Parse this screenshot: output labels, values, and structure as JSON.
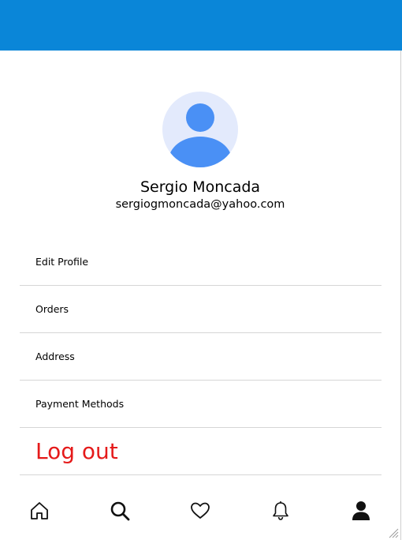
{
  "app": {
    "header_color": "#0a86d8"
  },
  "profile": {
    "name": "Sergio Moncada",
    "email": "sergiogmoncada@yahoo.com",
    "avatar_icon": "user-avatar-icon",
    "avatar_bg": "#e3eafc",
    "avatar_fg": "#4a90f5"
  },
  "menu": {
    "items": [
      {
        "label": "Edit Profile"
      },
      {
        "label": "Orders"
      },
      {
        "label": "Address"
      },
      {
        "label": "Payment Methods"
      }
    ],
    "logout_label": "Log out",
    "logout_color": "#e51a1a"
  },
  "bottom_nav": {
    "items": [
      {
        "icon": "home-icon"
      },
      {
        "icon": "search-icon"
      },
      {
        "icon": "heart-icon"
      },
      {
        "icon": "bell-icon"
      },
      {
        "icon": "profile-icon",
        "active": true
      }
    ]
  }
}
